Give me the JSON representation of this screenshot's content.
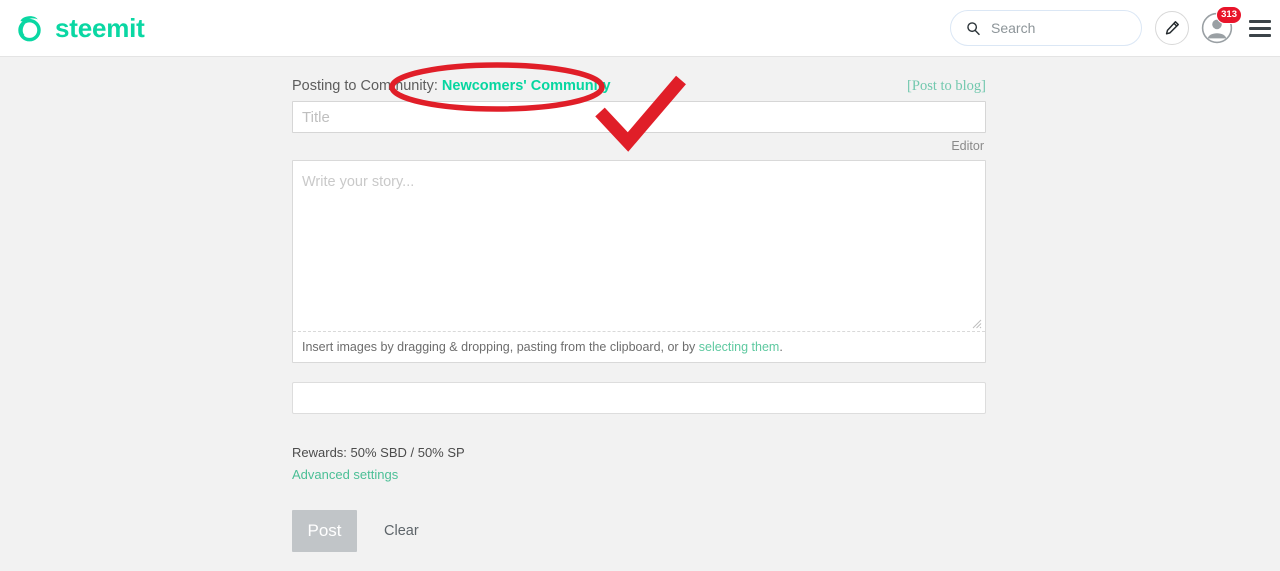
{
  "header": {
    "brand_name": "steemit",
    "brand_logo_icon": "steemit-logo-icon",
    "search": {
      "placeholder": "Search",
      "value": "",
      "icon": "search-icon"
    },
    "compose_icon": "pencil-icon",
    "avatar_icon": "user-avatar-icon",
    "notification_count": "313",
    "menu_icon": "hamburger-menu-icon"
  },
  "editor": {
    "posting_to_label": "Posting to Community:",
    "community_name": "Newcomers' Community",
    "post_to_blog_label": "[Post to blog]",
    "title_placeholder": "Title",
    "title_value": "",
    "editor_toggle_label": "Editor",
    "story_placeholder": "Write your story...",
    "story_value": "",
    "image_hint_text": "Insert images by dragging & dropping, pasting from the clipboard, or by ",
    "image_hint_link": "selecting them",
    "image_hint_suffix": ".",
    "tags_placeholder": "",
    "tags_value": "",
    "rewards_text": "Rewards: 50% SBD / 50% SP",
    "advanced_settings_label": "Advanced settings",
    "post_button_label": "Post",
    "clear_button_label": "Clear"
  },
  "annotations": {
    "ellipse": {
      "name": "red-ellipse-highlight",
      "target": "Newcomers' Community",
      "color": "#e01e28"
    },
    "checkmark": {
      "name": "red-checkmark-annotation",
      "color": "#e01e28"
    }
  },
  "colors": {
    "brand_green": "#0ad7a3",
    "link_green": "#4bbf96",
    "page_background": "#f2f2f2",
    "annotation_red": "#e01e28",
    "badge_red": "#e8142a"
  }
}
